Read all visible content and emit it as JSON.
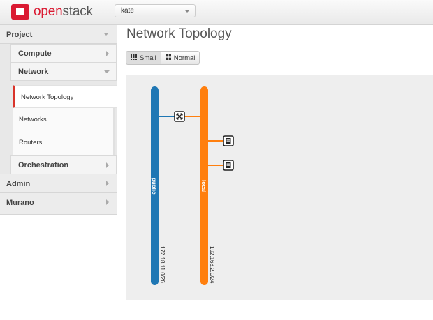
{
  "header": {
    "brand_part1": "open",
    "brand_part2": "stack",
    "tenant_selected": "kate"
  },
  "sidebar": {
    "dashboards": [
      {
        "label": "Project"
      },
      {
        "label": "Admin"
      },
      {
        "label": "Murano"
      }
    ],
    "panel_groups": [
      {
        "label": "Compute"
      },
      {
        "label": "Network"
      },
      {
        "label": "Orchestration"
      }
    ],
    "network_items": [
      {
        "label": "Network Topology",
        "active": true
      },
      {
        "label": "Networks"
      },
      {
        "label": "Routers"
      }
    ]
  },
  "page": {
    "title": "Network Topology",
    "view_buttons": [
      {
        "label": "Small",
        "icon": "small-grid-icon",
        "active": true
      },
      {
        "label": "Normal",
        "icon": "normal-grid-icon"
      }
    ]
  },
  "topology": {
    "networks": [
      {
        "name": "public",
        "cidr": "172.18.11.0/26",
        "color": "#1f77b4"
      },
      {
        "name": "local",
        "cidr": "192.168.2.0/24",
        "color": "#ff7f0e"
      }
    ],
    "devices": [
      {
        "icon": "router-icon"
      },
      {
        "icon": "instance-icon"
      },
      {
        "icon": "instance-icon"
      }
    ]
  }
}
